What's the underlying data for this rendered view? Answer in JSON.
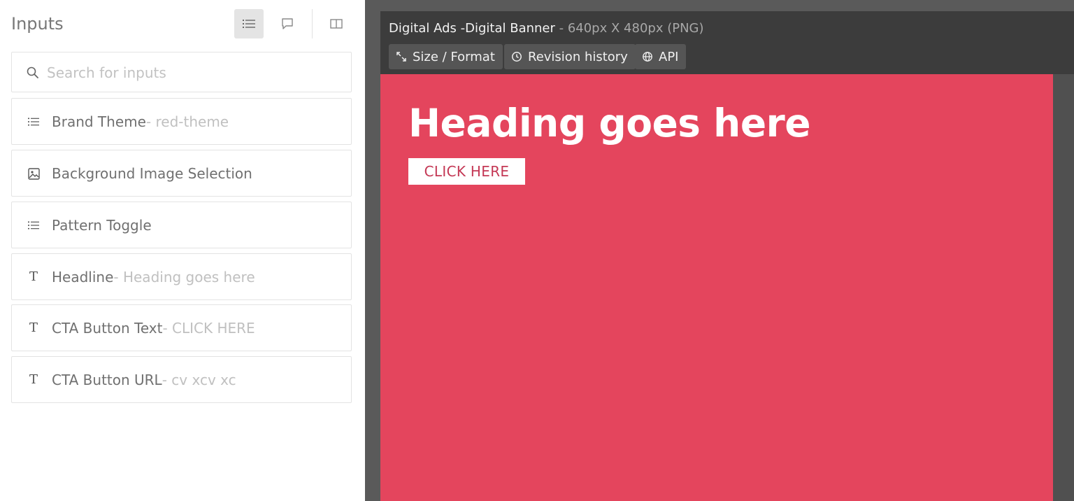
{
  "panel": {
    "title": "Inputs",
    "search": {
      "placeholder": "Search for inputs",
      "value": ""
    },
    "items": [
      {
        "label": "Brand Theme",
        "value": " - red-theme",
        "icon": "list-icon"
      },
      {
        "label": "Background Image Selection",
        "value": "",
        "icon": "image-icon"
      },
      {
        "label": "Pattern Toggle",
        "value": "",
        "icon": "list-icon"
      },
      {
        "label": "Headline",
        "value": " - Heading goes here",
        "icon": "text-icon"
      },
      {
        "label": "CTA Button Text",
        "value": " - CLICK HERE",
        "icon": "text-icon"
      },
      {
        "label": "CTA Button URL",
        "value": " - cv xcv xc",
        "icon": "text-icon"
      }
    ]
  },
  "editor": {
    "doc_name": "Digital Ads -Digital Banner",
    "doc_meta": " - 640px X 480px (PNG)",
    "toolbar": {
      "size_label": "Size / Format",
      "revision_label": "Revision history",
      "api_label": "API"
    }
  },
  "banner": {
    "heading": "Heading goes here",
    "cta": "CLICK HERE",
    "background_color": "#e4455d"
  }
}
